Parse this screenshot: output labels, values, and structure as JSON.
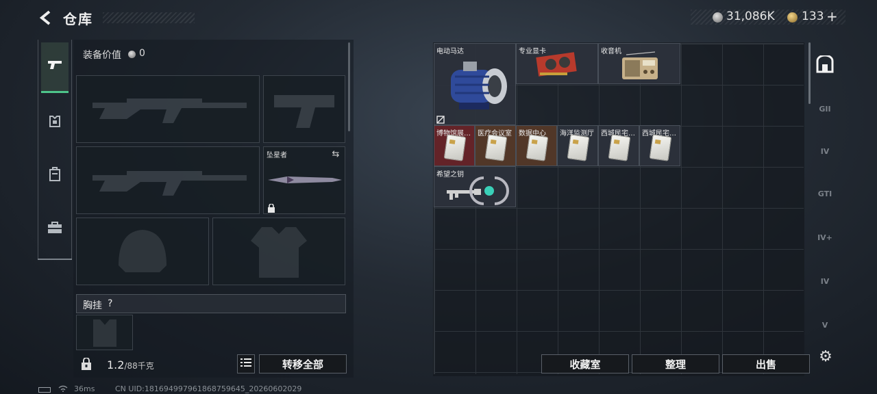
{
  "header": {
    "title": "仓库",
    "currency_silver": "31,086K",
    "currency_gold": "133",
    "add_symbol": "+"
  },
  "loadout": {
    "value_label": "装备价值",
    "value": "0",
    "melee_name": "坠星者",
    "chest_rig_label": "胸挂",
    "help_symbol": "?",
    "weight_current": "1.2",
    "weight_max": "/88千克",
    "transfer_all": "转移全部"
  },
  "storage": {
    "items": [
      {
        "label": "电动马达"
      },
      {
        "label": "专业显卡"
      },
      {
        "label": "收音机"
      },
      {
        "label": "博物馆展…"
      },
      {
        "label": "医疗会议室"
      },
      {
        "label": "数据中心"
      },
      {
        "label": "海洋监测厅"
      },
      {
        "label": "西城民宅…"
      },
      {
        "label": "西城民宅…"
      },
      {
        "label": "希望之钥"
      }
    ]
  },
  "sidebar_containers": [
    {
      "label": "GII"
    },
    {
      "label": "IV"
    },
    {
      "label": "GTI"
    },
    {
      "label": "IV+"
    },
    {
      "label": "IV"
    },
    {
      "label": "V"
    }
  ],
  "buttons": {
    "collection": "收藏室",
    "organize": "整理",
    "sell": "出售"
  },
  "status": {
    "ping": "36ms",
    "uid": "CN UID:1816949979618687596​45_20260602029"
  },
  "colors": {
    "accent": "#4ec58b",
    "red_tile": "#6c2428",
    "brown_tile": "#583a28"
  },
  "icons": [
    "back-arrow-icon",
    "pistol-icon",
    "armor-icon",
    "backpack-icon",
    "briefcase-icon",
    "lock-icon",
    "swap-icon",
    "list-icon",
    "settings-gear-icon",
    "safe-box-icon",
    "wifi-icon",
    "battery-icon",
    "no-insure-icon"
  ]
}
